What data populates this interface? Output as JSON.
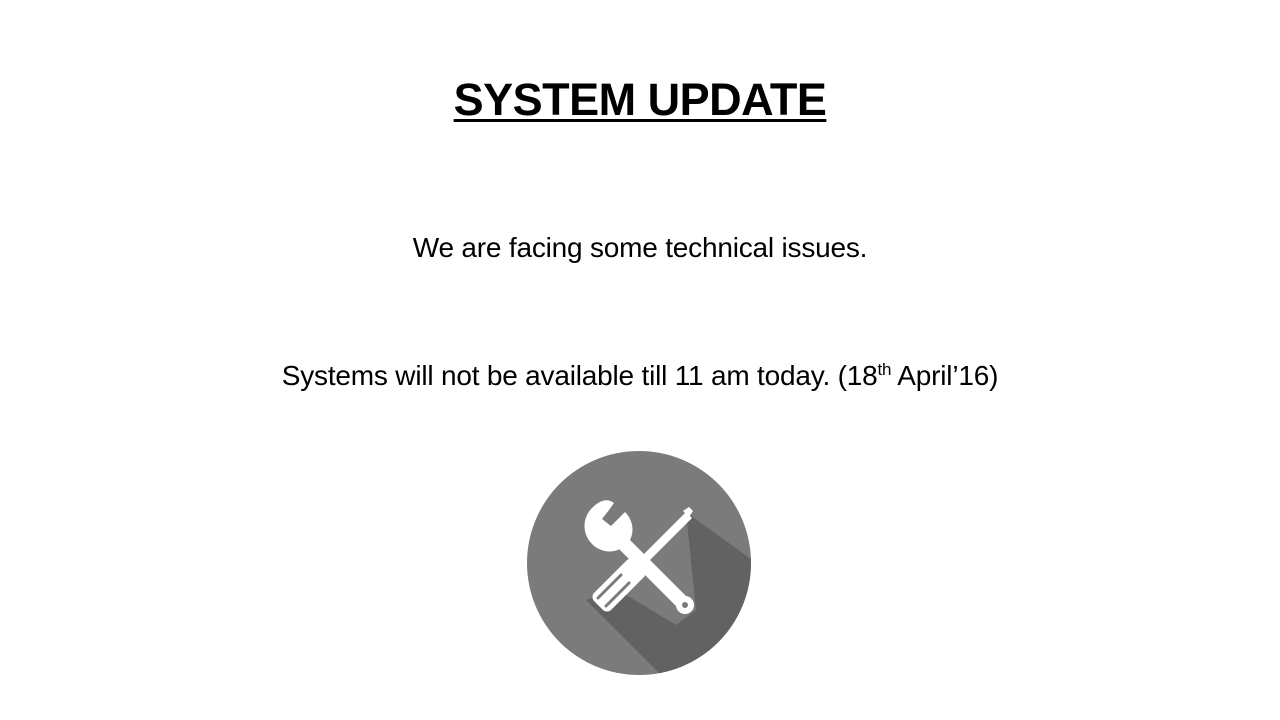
{
  "slide": {
    "title": "SYSTEM UPDATE",
    "message": "We are facing some technical issues.",
    "availability_prefix": "Systems will not be available till 11 am today. (18",
    "availability_superscript": "th",
    "availability_suffix": " April’16)",
    "icon": "wrench-screwdriver-tools-icon"
  },
  "colors": {
    "background": "#ffffff",
    "text": "#000000",
    "icon_circle": "#7a7a7a",
    "icon_shadow": "#5e5e5e",
    "icon_tools": "#ffffff"
  }
}
